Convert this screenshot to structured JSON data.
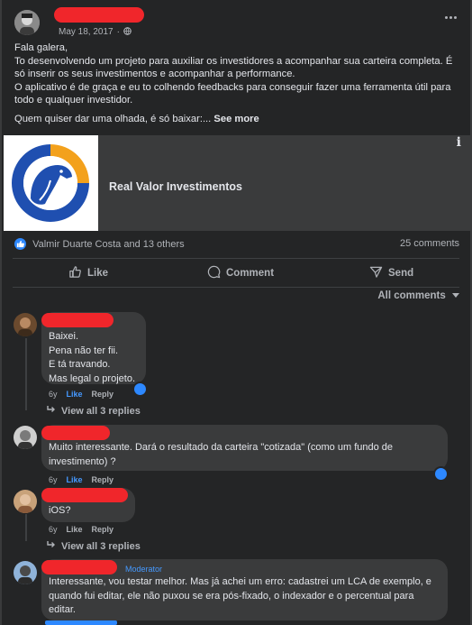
{
  "post": {
    "timestamp": "May 18, 2017",
    "privacy_icon": "globe-icon",
    "more_icon": "more-icon",
    "greeting": "Fala galera,",
    "paragraph_1": "To desenvolvendo um projeto para auxiliar os investidores a acompanhar sua carteira completa. É só inserir os seus investimentos e acompanhar a performance.",
    "paragraph_2": "O aplicativo é de graça e eu to colhendo feedbacks para conseguir  fazer uma ferramenta útil para todo e qualquer investidor.",
    "paragraph_3": "Quem quiser dar uma olhada, é só baixar:...",
    "see_more": "See more"
  },
  "link_preview": {
    "title": "Real Valor Investimentos",
    "info_icon": "i"
  },
  "reactions": {
    "summary": "Valmir Duarte Costa and 13 others",
    "comments_count": "25 comments"
  },
  "actions": {
    "like": "Like",
    "comment": "Comment",
    "send": "Send"
  },
  "sort_label": "All comments",
  "comments": [
    {
      "lines": [
        "Baixei.",
        "Pena não ter fii.",
        "E tá travando.",
        "Mas legal o projeto."
      ],
      "age": "6y",
      "like": "Like",
      "reply": "Reply",
      "view_replies": "View all 3 replies"
    },
    {
      "text": "Muito interessante. Dará o resultado da carteira \"cotizada\" (como um fundo de investimento) ?",
      "age": "6y",
      "like": "Like",
      "reply": "Reply"
    },
    {
      "text": "iOS?",
      "age": "6y",
      "like": "Like",
      "reply": "Reply",
      "view_replies": "View all 3 replies"
    },
    {
      "badge": "Moderator",
      "text": "Interessante, vou testar melhor. Mas já achei um erro: cadastrei um LCA de exemplo, e quando fui editar, ele não puxou se era pós-fixado, o indexador e o percentual para editar."
    }
  ],
  "colors": {
    "background": "#242526",
    "bubble": "#3a3b3c",
    "accent_blue": "#2d88ff",
    "redaction": "#f0262b",
    "logo_blue": "#1f4fb0",
    "logo_orange": "#f3a11c"
  }
}
